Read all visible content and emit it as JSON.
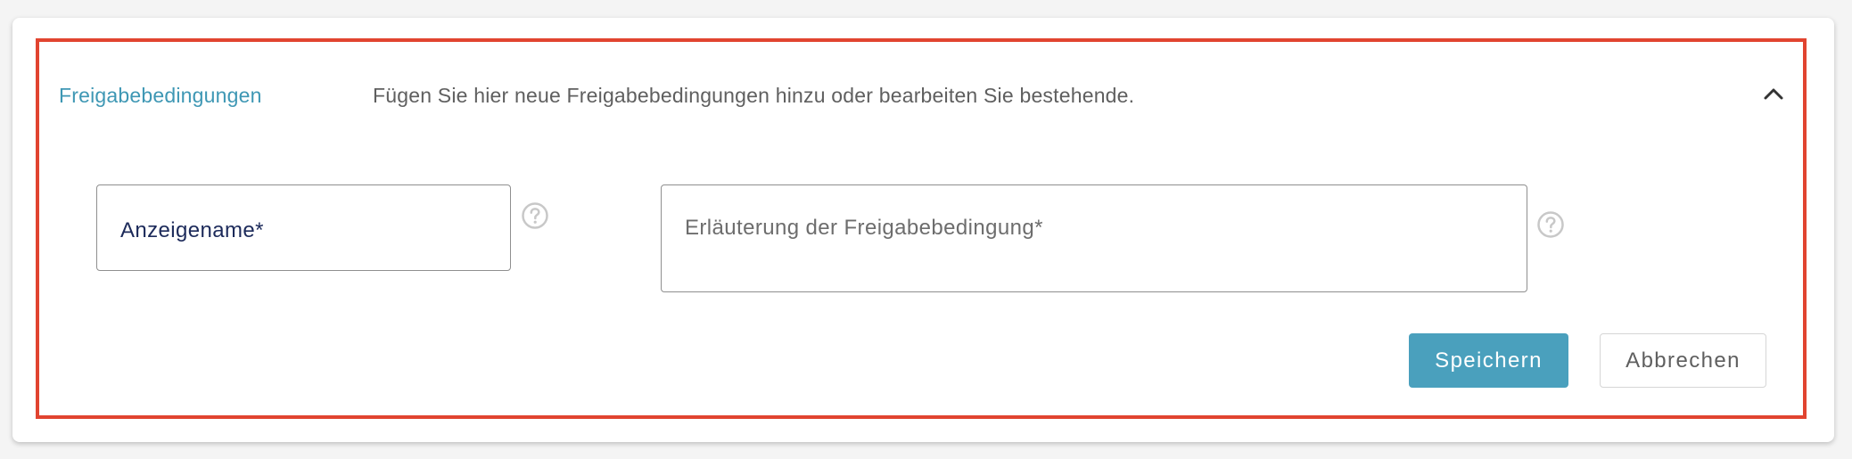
{
  "panel": {
    "title": "Freigabebedingungen",
    "description": "Fügen Sie hier neue Freigabebedingungen hinzu oder bearbeiten Sie bestehende.",
    "collapse_icon": "chevron-up-icon"
  },
  "form": {
    "display_name_label": "Anzeigename*",
    "explanation_label": "Erläuterung der Freigabebedingung*",
    "help_icon": "question-circle-icon"
  },
  "actions": {
    "save_label": "Speichern",
    "cancel_label": "Abbrechen"
  },
  "colors": {
    "accent": "#4aa0bd",
    "title": "#3e97b4",
    "highlight_border": "#e14430"
  }
}
